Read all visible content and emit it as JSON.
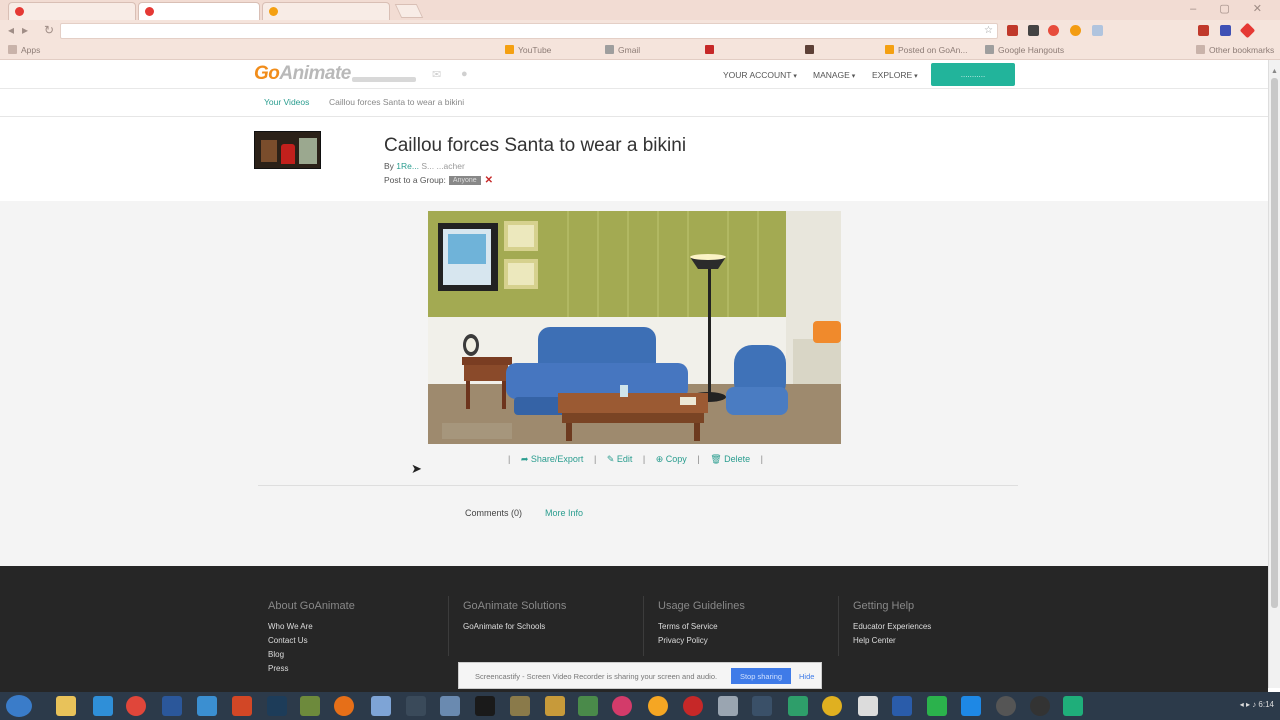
{
  "browser": {
    "tabs": [
      "",
      "",
      "",
      ""
    ],
    "address": "",
    "window_controls": "– ▢ ✕",
    "bookmarks": [
      "Apps",
      "YouTube",
      "Gmail",
      "",
      "",
      "Posted on GoAn...",
      "Google Hangouts",
      "Other bookmarks"
    ]
  },
  "site": {
    "logo_go": "Go",
    "logo_animate": "Animate",
    "menu": {
      "account": "YOUR ACCOUNT",
      "manage": "MANAGE",
      "explore": "EXPLORE"
    },
    "cta_label": "..........."
  },
  "breadcrumb": {
    "link": "Your Videos",
    "current": "Caillou forces Santa to wear a bikini"
  },
  "video": {
    "title": "Caillou forces Santa to wear a bikini",
    "by_label": "By",
    "author": "1Re...",
    "author_role": "S...  ...acher",
    "group_label": "Post to a Group:",
    "group_value": "Anyone"
  },
  "actions": {
    "share": "Share/Export",
    "edit": "Edit",
    "copy": "Copy",
    "delete": "Delete",
    "separator": "|"
  },
  "tabs": {
    "comments": "Comments (0)",
    "more_info": "More Info"
  },
  "footer": {
    "columns": [
      {
        "title": "About GoAnimate",
        "links": [
          "Who We Are",
          "Contact Us",
          "Blog",
          "Press"
        ]
      },
      {
        "title": "GoAnimate Solutions",
        "links": [
          "GoAnimate for Schools"
        ]
      },
      {
        "title": "Usage Guidelines",
        "links": [
          "Terms of Service",
          "Privacy Policy"
        ]
      },
      {
        "title": "Getting Help",
        "links": [
          "Educator Experiences",
          "Help Center"
        ]
      }
    ]
  },
  "screencast_banner": {
    "text": "Screencastify - Screen Video Recorder is sharing your screen and audio.",
    "stop": "Stop sharing",
    "hide": "Hide"
  },
  "taskbar": {
    "clock": "6:14"
  },
  "colors": {
    "accent": "#2a9d8f",
    "brand_orange": "#f18d1b",
    "cta": "#22b49b",
    "footer_bg": "#262626"
  }
}
